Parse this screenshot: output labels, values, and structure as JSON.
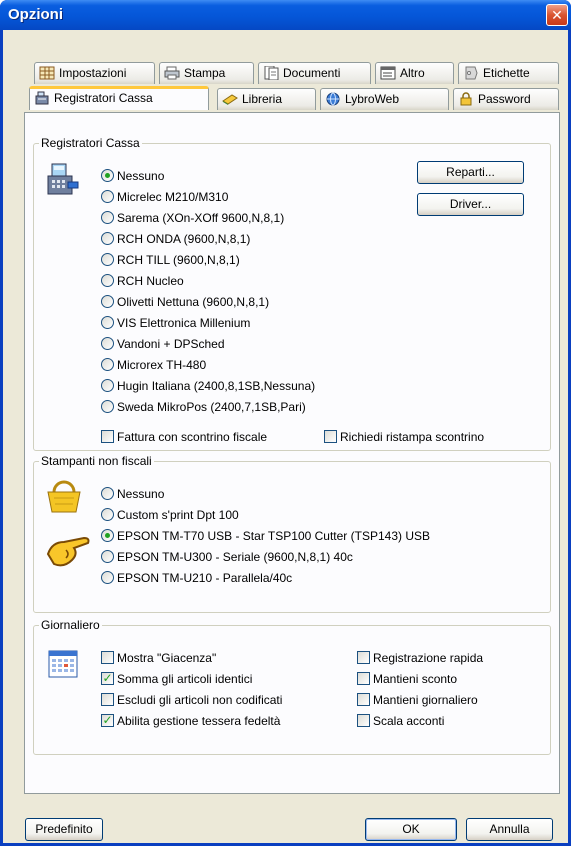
{
  "window": {
    "title": "Opzioni",
    "close": "✕"
  },
  "tabs_row1": [
    "Impostazioni",
    "Stampa",
    "Documenti",
    "Altro",
    "Etichette"
  ],
  "tabs_row2": [
    "Registratori Cassa",
    "Libreria",
    "LybroWeb",
    "Password"
  ],
  "active_tab": "Registratori Cassa",
  "registratori": {
    "title": "Registratori Cassa",
    "options": [
      "Nessuno",
      "Micrelec M210/M310",
      "Sarema (XOn-XOff 9600,N,8,1)",
      "RCH ONDA (9600,N,8,1)",
      "RCH TILL (9600,N,8,1)",
      "RCH Nucleo",
      "Olivetti Nettuna (9600,N,8,1)",
      "VIS Elettronica Millenium",
      "Vandoni + DPSched",
      "Microrex TH-480",
      "Hugin Italiana (2400,8,1SB,Nessuna)",
      "Sweda MikroPos (2400,7,1SB,Pari)"
    ],
    "selected": "Nessuno",
    "reparti_label": "Reparti...",
    "driver_label": "Driver...",
    "fattura_label": "Fattura con scontrino fiscale",
    "fattura_checked": false,
    "ristampa_label": "Richiedi ristampa scontrino",
    "ristampa_checked": false
  },
  "stampanti": {
    "title": "Stampanti non fiscali",
    "options": [
      "Nessuno",
      "Custom s'print Dpt 100",
      "EPSON TM-T70 USB - Star TSP100 Cutter (TSP143) USB",
      "EPSON TM-U300 - Seriale (9600,N,8,1) 40c",
      "EPSON TM-U210 - Parallela/40c"
    ],
    "selected": "EPSON TM-T70 USB - Star TSP100 Cutter (TSP143) USB"
  },
  "giornaliero": {
    "title": "Giornaliero",
    "left": [
      {
        "label": "Mostra \"Giacenza\"",
        "checked": false
      },
      {
        "label": "Somma gli articoli identici",
        "checked": true
      },
      {
        "label": "Escludi gli articoli non codificati",
        "checked": false
      },
      {
        "label": "Abilita gestione tessera fedeltà",
        "checked": true
      }
    ],
    "right": [
      {
        "label": "Registrazione rapida",
        "checked": false
      },
      {
        "label": "Mantieni sconto",
        "checked": false
      },
      {
        "label": "Mantieni giornaliero",
        "checked": false
      },
      {
        "label": "Scala acconti",
        "checked": false
      }
    ]
  },
  "footer": {
    "predefinito": "Predefinito",
    "ok": "OK",
    "annulla": "Annulla"
  },
  "colors": {
    "titlebar": "#0556d8",
    "face": "#ece9d8",
    "panel": "#fcfcfe",
    "radio_dot": "#21a121",
    "tab_highlight": "#ffc83c"
  }
}
